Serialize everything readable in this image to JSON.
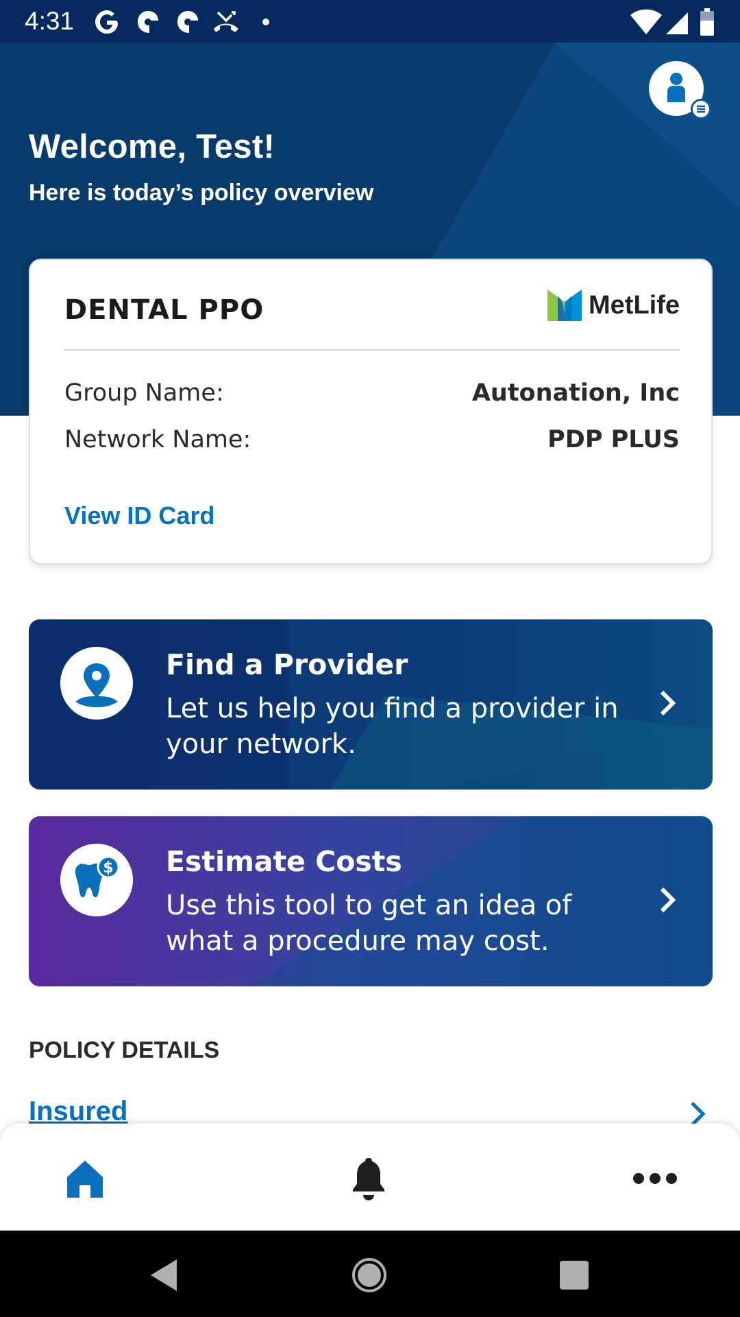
{
  "status_bar": {
    "time": "4:31",
    "notification_icons": [
      "google-icon",
      "pinwheel-icon",
      "pinwheel-icon",
      "missed-call-icon",
      "dot-icon"
    ],
    "right_icons": [
      "wifi-icon",
      "signal-icon",
      "battery-icon"
    ]
  },
  "header": {
    "welcome": "Welcome, Test!",
    "subtitle": "Here is today’s policy overview"
  },
  "policy_card": {
    "plan_name": "DENTAL PPO",
    "carrier_logo_text": "MetLife",
    "rows": [
      {
        "label": "Group Name:",
        "value": "Autonation, Inc"
      },
      {
        "label": "Network Name:",
        "value": "PDP PLUS"
      }
    ],
    "link": "View ID Card"
  },
  "tiles": [
    {
      "title": "Find a Provider",
      "description": "Let us help you find a provider in your network.",
      "icon": "location-pin-icon"
    },
    {
      "title": "Estimate Costs",
      "description": "Use this tool to get an idea of what a procedure may cost.",
      "icon": "tooth-dollar-icon"
    }
  ],
  "policy_details": {
    "heading": "POLICY DETAILS",
    "items": [
      {
        "label": "Insured"
      }
    ]
  },
  "bottom_nav": [
    "home-icon",
    "bell-icon",
    "more-icon"
  ],
  "colors": {
    "hero": "#083a6b",
    "link": "#0a6fbd",
    "tile_provider": "#0b2d6b",
    "tile_estimate_start": "#5b2a9e",
    "tile_estimate_end": "#134b8a",
    "metlife_green": "#8dc63f",
    "metlife_blue": "#0090da"
  }
}
